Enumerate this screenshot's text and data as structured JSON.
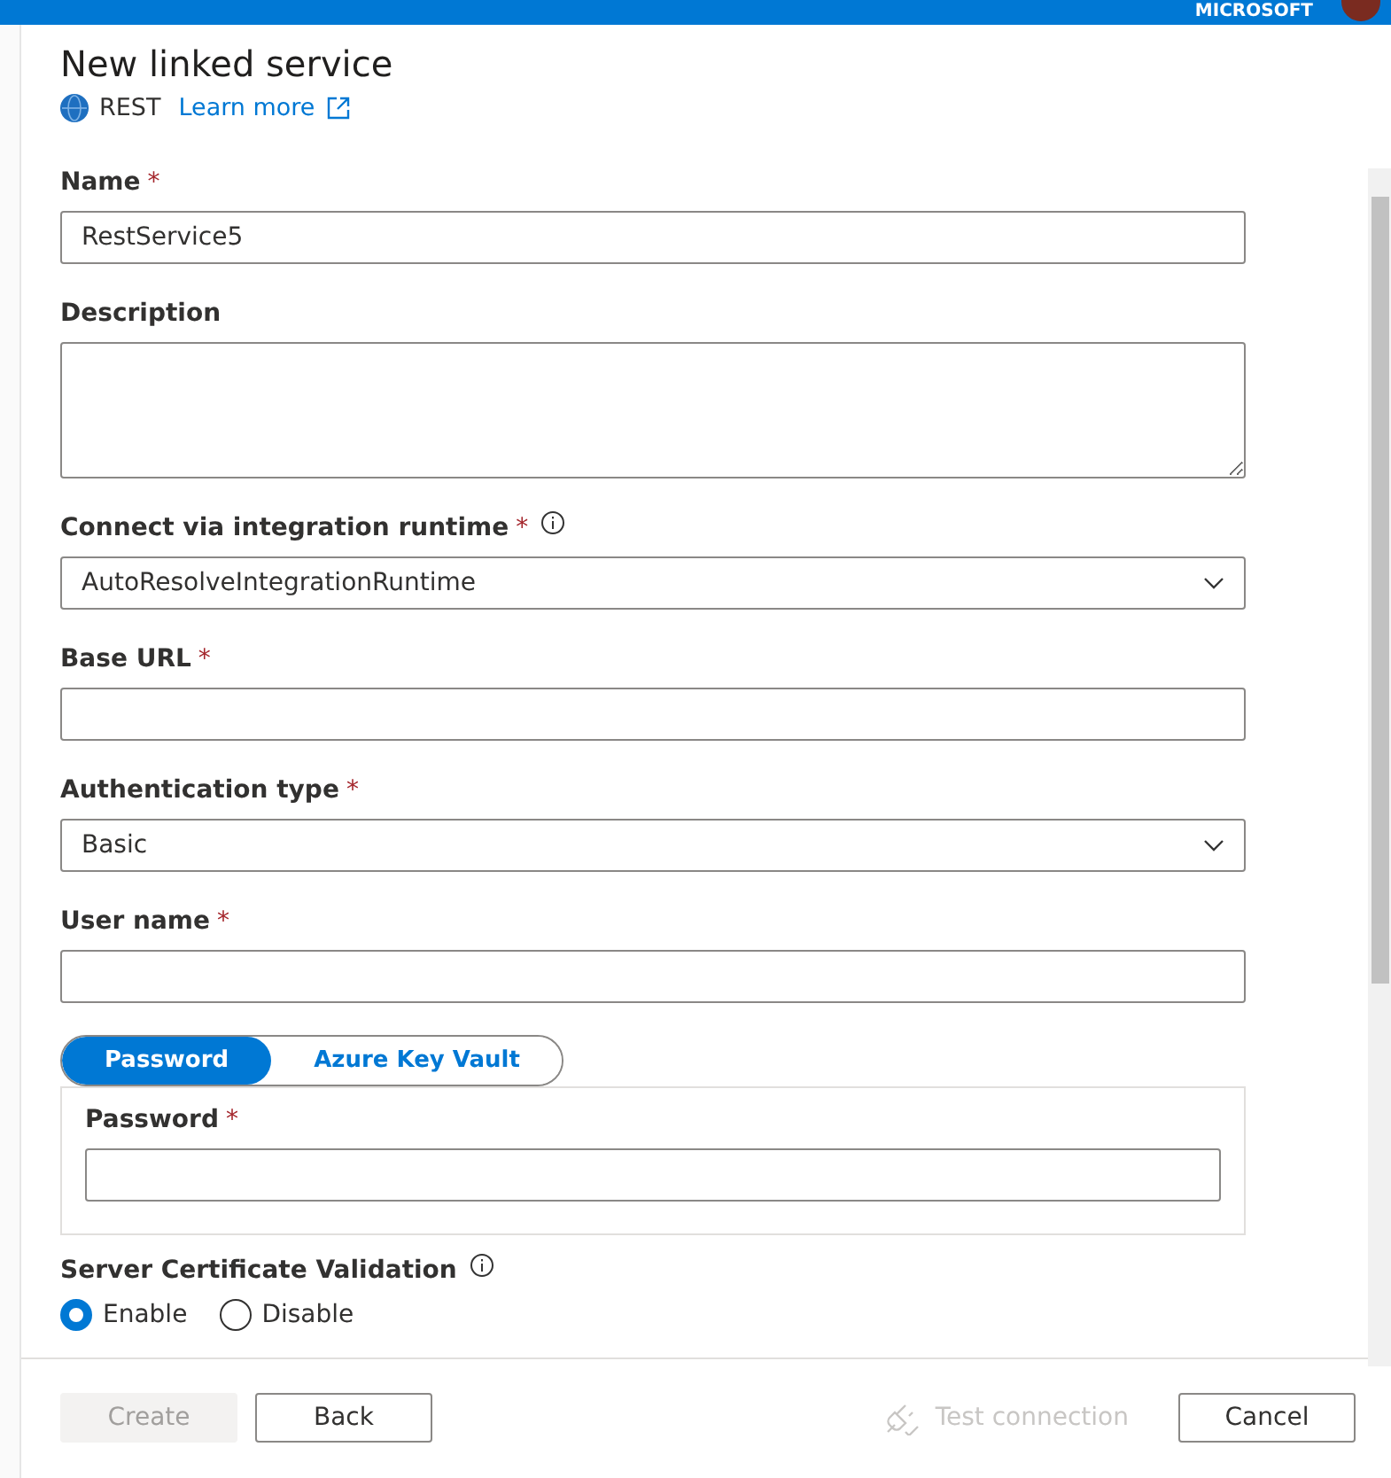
{
  "top_bar": {
    "account": "MICROSOFT"
  },
  "panel": {
    "title": "New linked service",
    "connector": {
      "name": "REST",
      "link": "Learn more"
    }
  },
  "fields": [
    {
      "kind": "text",
      "label": "Name",
      "required_mark": "*",
      "info": false,
      "value": "RestService5"
    },
    {
      "kind": "textarea",
      "label": "Description",
      "info": false
    },
    {
      "kind": "select",
      "label": "Connect via integration runtime",
      "required_mark": "*",
      "info": true,
      "value": "AutoResolveIntegrationRuntime"
    },
    {
      "kind": "text",
      "label": "Base URL",
      "required_mark": "*",
      "info": false
    },
    {
      "kind": "select",
      "label": "Authentication type",
      "required_mark": "*",
      "info": false,
      "value": "Basic"
    },
    {
      "kind": "text",
      "label": "User name",
      "required_mark": "*",
      "info": false
    }
  ],
  "secret_tabs": [
    {
      "label": "Password",
      "selected": true
    },
    {
      "label": "Azure Key Vault",
      "selected": false
    }
  ],
  "secret_field": {
    "label": "Password",
    "required_mark": "*"
  },
  "certificate": {
    "label": "Server Certificate Validation",
    "info": true,
    "options": [
      {
        "label": "Enable",
        "selected": true
      },
      {
        "label": "Disable",
        "selected": false
      }
    ]
  },
  "footer": {
    "buttons": [
      {
        "label": "Create",
        "disabled": true
      },
      {
        "label": "Back",
        "disabled": false
      }
    ],
    "test_connection": {
      "label": "Test connection",
      "disabled": true
    },
    "cancel": {
      "label": "Cancel",
      "disabled": false
    }
  }
}
